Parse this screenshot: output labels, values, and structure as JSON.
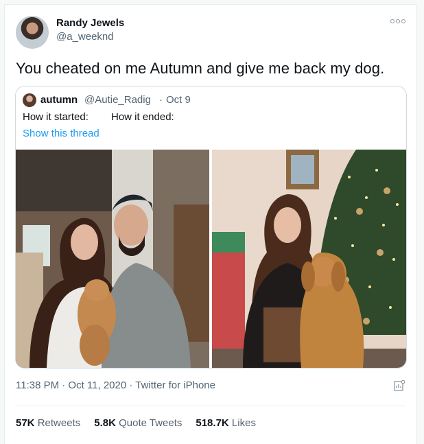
{
  "author": {
    "name": "Randy Jewels",
    "handle": "@a_weeknd"
  },
  "tweet": {
    "text": "You cheated on me Autumn and give me back my dog."
  },
  "quoted": {
    "name": "autumn",
    "handle": "@Autie_Radig",
    "separator": "·",
    "date": "Oct 9",
    "text_left": "How it started:",
    "text_right": "How it ended:",
    "thread_link": "Show this thread"
  },
  "meta": {
    "timestamp": "11:38 PM · Oct 11, 2020 · ",
    "source": "Twitter for iPhone"
  },
  "stats": {
    "retweets_count": "57K",
    "retweets_label": "Retweets",
    "quotes_count": "5.8K",
    "quotes_label": "Quote Tweets",
    "likes_count": "518.7K",
    "likes_label": "Likes"
  },
  "colors": {
    "link": "#1d9bf0",
    "secondary_text": "#536471",
    "border": "#cfd9de"
  }
}
